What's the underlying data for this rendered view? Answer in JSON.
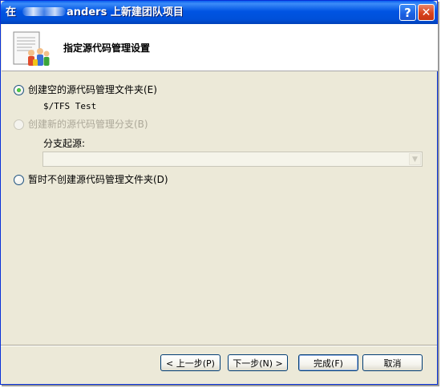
{
  "window": {
    "title_prefix": "在",
    "title_suffix": "anders 上新建团队项目",
    "help_glyph": "?",
    "close_glyph": "✕"
  },
  "header": {
    "title": "指定源代码管理设置",
    "icon": "project-wizard-icon"
  },
  "options": {
    "create_empty": {
      "label": "创建空的源代码管理文件夹(E)",
      "selected": true,
      "enabled": true
    },
    "path": "$/TFS Test",
    "create_branch": {
      "label": "创建新的源代码管理分支(B)",
      "selected": false,
      "enabled": false
    },
    "branch_source_label": "分支起源:",
    "branch_source_value": "",
    "no_folder": {
      "label": "暂时不创建源代码管理文件夹(D)",
      "selected": false,
      "enabled": true
    }
  },
  "buttons": {
    "back": "< 上一步(P)",
    "next": "下一步(N) >",
    "finish": "完成(F)",
    "cancel": "取消"
  },
  "colors": {
    "titlebar": "#0054e3",
    "dialog_face": "#ece9d8",
    "accent_border": "#003c74"
  }
}
